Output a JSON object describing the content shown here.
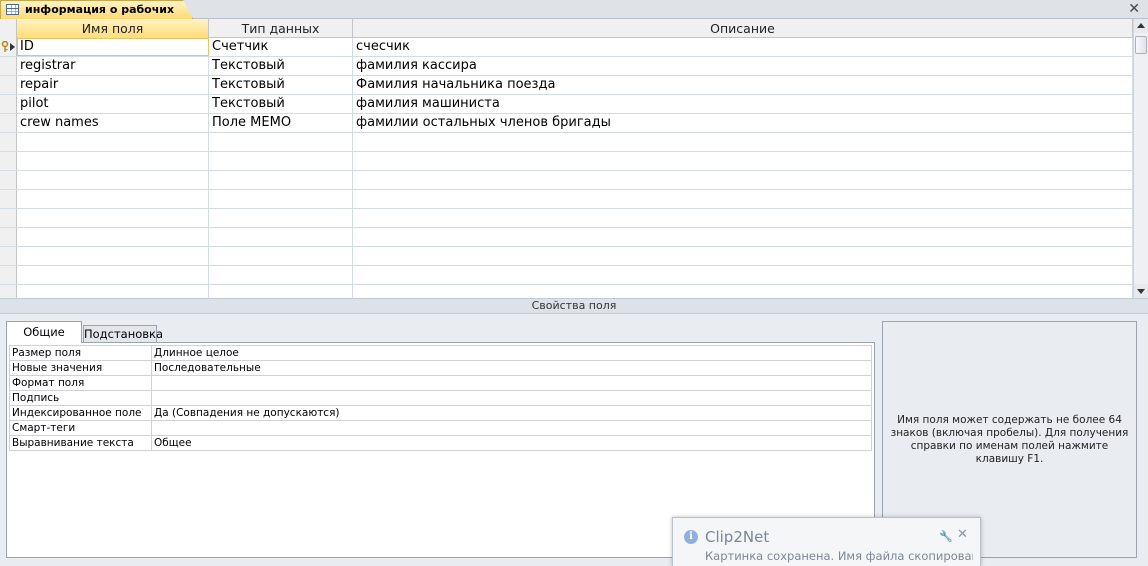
{
  "document_tab": {
    "title": "информация о рабочих",
    "close_glyph": "✕",
    "icon": "table-icon"
  },
  "grid": {
    "columns": [
      "Имя поля",
      "Тип данных",
      "Описание"
    ],
    "rows": [
      {
        "name": "ID",
        "type": "Счетчик",
        "description": "счесчик"
      },
      {
        "name": "registrar",
        "type": "Текстовый",
        "description": "фамилия кассира"
      },
      {
        "name": "repair",
        "type": "Текстовый",
        "description": "Фамилия начальника поезда"
      },
      {
        "name": "pilot",
        "type": "Текстовый",
        "description": "фамилия машиниста"
      },
      {
        "name": "crew names",
        "type": "Поле MEMO",
        "description": "фамилии остальных членов бригады"
      }
    ],
    "empty_rows": 9,
    "active_row": 0,
    "primary_key_row": 0
  },
  "properties": {
    "title": "Свойства поля",
    "tabs": [
      "Общие",
      "Подстановка"
    ],
    "active_tab": 0,
    "rows": [
      {
        "name": "Размер поля",
        "value": "Длинное целое"
      },
      {
        "name": "Новые значения",
        "value": "Последовательные"
      },
      {
        "name": "Формат поля",
        "value": ""
      },
      {
        "name": "Подпись",
        "value": ""
      },
      {
        "name": "Индексированное поле",
        "value": "Да (Совпадения не допускаются)"
      },
      {
        "name": "Смарт-теги",
        "value": ""
      },
      {
        "name": "Выравнивание текста",
        "value": "Общее"
      }
    ],
    "help_text": "Имя поля может содержать не более 64 знаков (включая пробелы). Для получения справки по именам полей нажмите клавишу F1."
  },
  "notification": {
    "title": "Clip2Net",
    "message": "Картинка сохранена. Имя файла скопировано в",
    "info_glyph": "i",
    "close_glyph": "✕",
    "settings_glyph": "🔧"
  },
  "colors": {
    "accent": "#ffdc7a",
    "grid_line": "#d4dbe4",
    "panel_bg": "#e9ecf0"
  }
}
